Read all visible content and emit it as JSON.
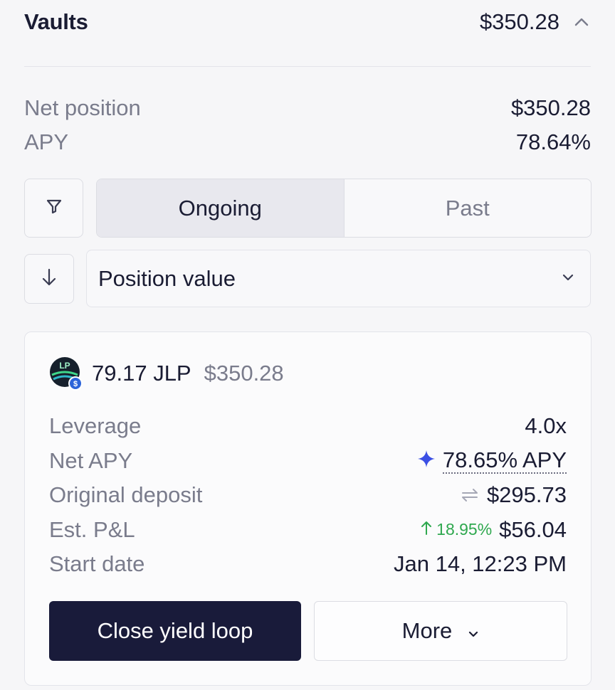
{
  "header": {
    "title": "Vaults",
    "total": "$350.28",
    "collapse_icon": "chevron-up-icon"
  },
  "summary": {
    "net_position_label": "Net position",
    "net_position_value": "$350.28",
    "apy_label": "APY",
    "apy_value": "78.64%"
  },
  "filters": {
    "filter_icon": "filter-icon",
    "tabs": [
      {
        "label": "Ongoing",
        "active": true
      },
      {
        "label": "Past",
        "active": false
      }
    ]
  },
  "sort": {
    "direction_icon": "arrow-down-icon",
    "selected": "Position value",
    "dropdown_icon": "chevron-down-icon"
  },
  "position": {
    "token_icon": "jlp-token-icon",
    "amount": "79.17 JLP",
    "usd_value": "$350.28",
    "rows": {
      "leverage_label": "Leverage",
      "leverage_value": "4.0x",
      "net_apy_label": "Net APY",
      "net_apy_value": "78.65% APY",
      "original_deposit_label": "Original deposit",
      "original_deposit_value": "$295.73",
      "pnl_label": "Est. P&L",
      "pnl_percent": "18.95%",
      "pnl_value": "$56.04",
      "start_date_label": "Start date",
      "start_date_value": "Jan 14, 12:23 PM"
    },
    "actions": {
      "primary_label": "Close yield loop",
      "secondary_label": "More"
    }
  },
  "colors": {
    "primary_button": "#191b3a",
    "positive": "#2fa84f",
    "sparkle": "#3b4fe4",
    "muted_text": "#7a7c8c"
  }
}
